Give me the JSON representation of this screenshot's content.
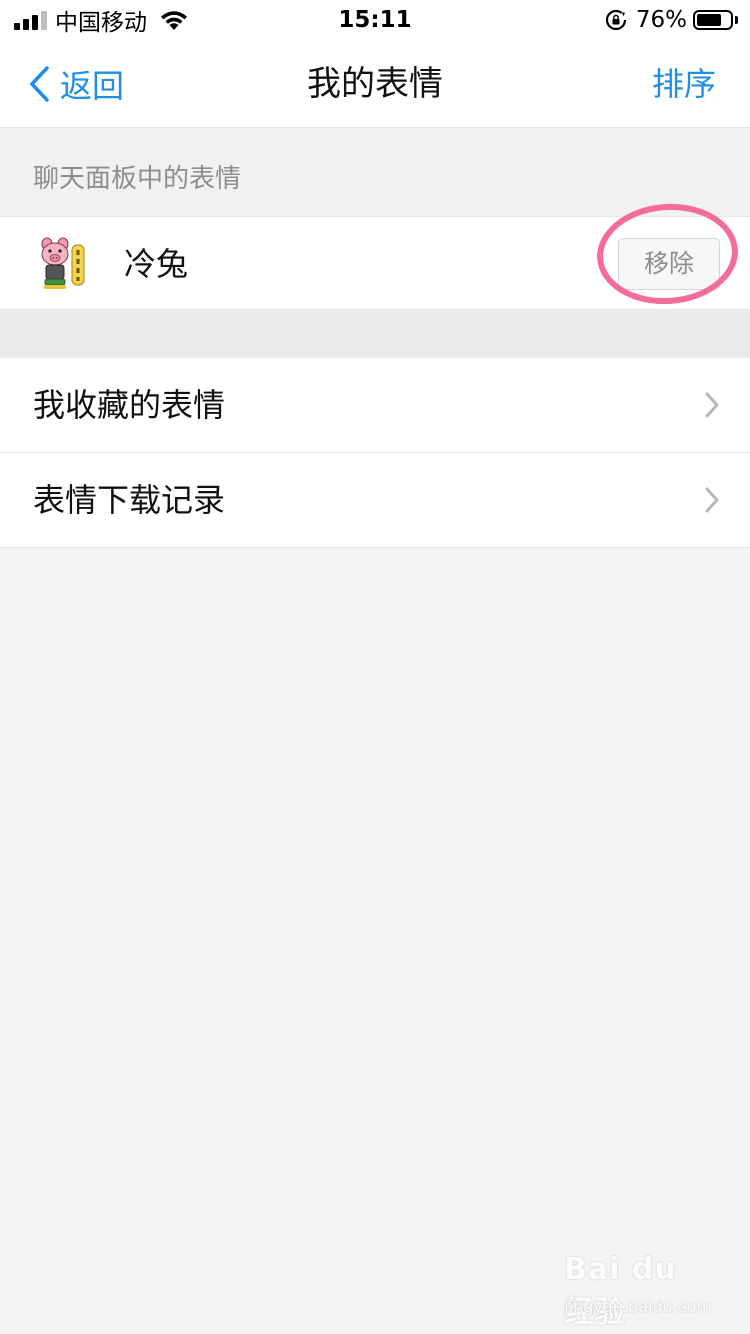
{
  "status_bar": {
    "carrier": "中国移动",
    "time": "15:11",
    "battery_percent": "76%",
    "battery_level": 0.76,
    "icons": [
      "signal-icon",
      "wifi-icon",
      "rotation-lock-icon",
      "battery-icon"
    ]
  },
  "nav": {
    "back_label": "返回",
    "title": "我的表情",
    "sort_label": "排序",
    "accent_color": "#1f8fe5",
    "icons": [
      "chevron-left-icon"
    ]
  },
  "panel_section": {
    "header": "聊天面板中的表情",
    "items": [
      {
        "name": "冷兔",
        "action_label": "移除",
        "icon": "pig-sticker-icon"
      }
    ],
    "highlight_color": "#f46d97"
  },
  "menu": {
    "items": [
      {
        "label": "我收藏的表情",
        "icon": "chevron-right-icon"
      },
      {
        "label": "表情下载记录",
        "icon": "chevron-right-icon"
      }
    ]
  },
  "watermark": {
    "logo": "Bai du 经验",
    "url": "jingyan.baidu.com"
  }
}
